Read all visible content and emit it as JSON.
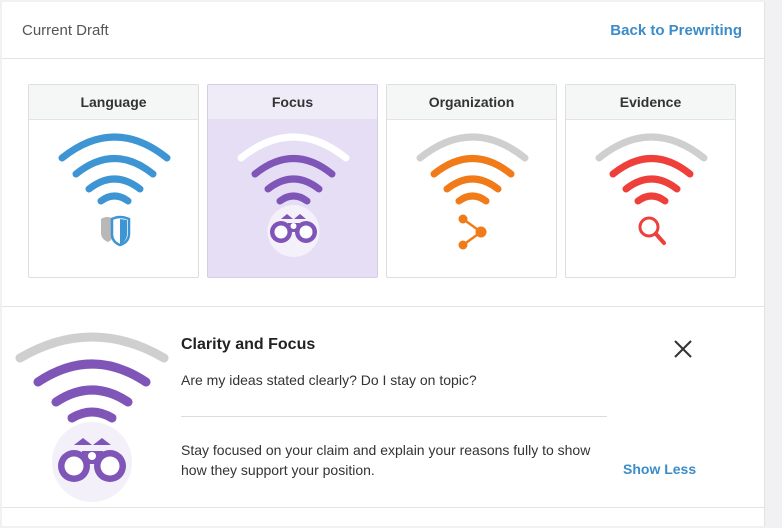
{
  "header": {
    "title": "Current Draft",
    "back_label": "Back to Prewriting"
  },
  "cards": [
    {
      "label": "Language",
      "color": "#3d95d3",
      "icon": "shield-icon",
      "selected": false,
      "signal_level": 1.0
    },
    {
      "label": "Focus",
      "color": "#7f55b8",
      "icon": "binoculars-icon",
      "selected": true,
      "signal_level": 0.75
    },
    {
      "label": "Organization",
      "color": "#f07b18",
      "icon": "share-nodes-icon",
      "selected": false,
      "signal_level": 0.75
    },
    {
      "label": "Evidence",
      "color": "#ef3f3a",
      "icon": "magnifier-icon",
      "selected": false,
      "signal_level": 0.75
    }
  ],
  "detail": {
    "title": "Clarity and Focus",
    "question": "Are my ideas stated clearly? Do I stay on topic?",
    "body": "Stay focused on your claim and explain your reasons fully to show how they support your position.",
    "show_less_label": "Show Less",
    "icon": "binoculars-icon",
    "color": "#7f55b8",
    "signal_level": 0.75
  },
  "colors": {
    "link": "#3b8cc9",
    "inactive_arc": "#cfcfcf",
    "selected_bg": "#e6def4"
  }
}
